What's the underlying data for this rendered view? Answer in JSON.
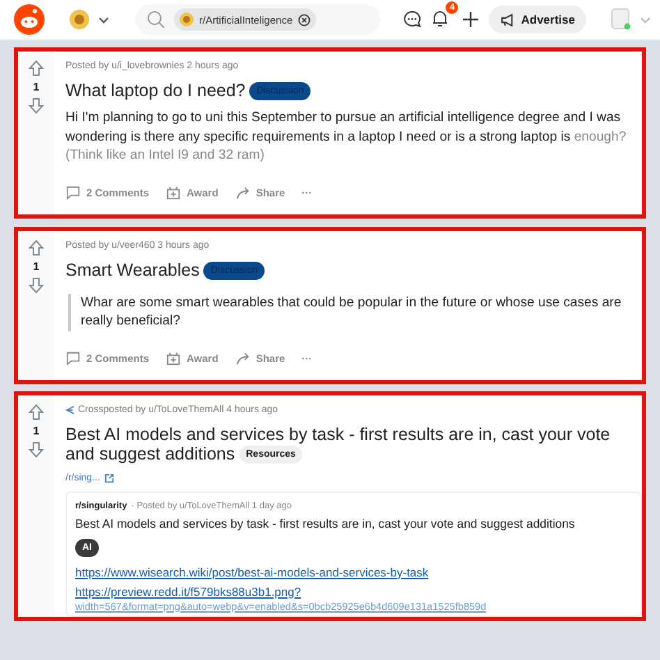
{
  "header": {
    "search_chip": "r/ArtificialInteligence",
    "notification_count": "4",
    "advertise_label": "Advertise"
  },
  "posts": [
    {
      "kind": "text",
      "score": "1",
      "meta": "Posted by u/i_lovebrownies 2 hours ago",
      "title": "What laptop do I need?",
      "flair": {
        "label": "Discussion",
        "kind": "dark"
      },
      "body": {
        "kind": "plain",
        "text": "Hi I'm planning to go to uni this September to pursue an artificial intelligence degree and I was wondering is there any specific requirements in a laptop I need or is a strong laptop is",
        "faded": "enough? (Think like an Intel I9 and 32 ram)"
      },
      "actions": [
        {
          "kind": "comments",
          "label": "2 Comments"
        },
        {
          "kind": "award",
          "label": "Award"
        },
        {
          "kind": "share",
          "label": "Share"
        },
        {
          "kind": "more",
          "label": "···"
        }
      ]
    },
    {
      "kind": "text",
      "score": "1",
      "meta": "Posted by u/veer460 3 hours ago",
      "title": "Smart Wearables",
      "flair": {
        "label": "Discussion",
        "kind": "dark"
      },
      "body": {
        "kind": "quote",
        "text": "Whar are some smart wearables that could be popular in the future or whose use cases are really beneficial?"
      },
      "actions": [
        {
          "kind": "comments",
          "label": "2 Comments"
        },
        {
          "kind": "award",
          "label": "Award"
        },
        {
          "kind": "share",
          "label": "Share"
        },
        {
          "kind": "more",
          "label": "···"
        }
      ]
    },
    {
      "kind": "crosspost",
      "score": "1",
      "meta": "Crossposted by u/ToLoveThemAll 4 hours ago",
      "title": "Best AI models and services by task - first results are in, cast your vote and suggest additions",
      "flair": {
        "label": "Resources",
        "kind": "light"
      },
      "source_link": "/r/sing...",
      "embedded": {
        "subreddit": "r/singularity",
        "meta": "· Posted by u/ToLoveThemAll 1 day ago",
        "title": "Best AI models and services by task - first results are in, cast your vote and suggest additions",
        "flair": {
          "label": "AI",
          "kind": "black"
        },
        "links": [
          "https://www.wisearch.wiki/post/best-ai-models-and-services-by-task",
          "https://preview.redd.it/f579bks88u3b1.png?",
          "width=567&format=png&auto=webp&v=enabled&s=0bcb25925e6b4d609e131a1525fb859d"
        ]
      }
    }
  ]
}
